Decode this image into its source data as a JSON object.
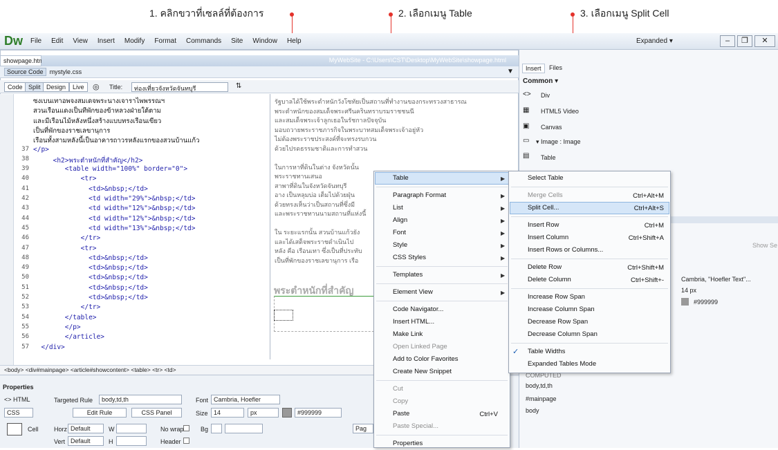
{
  "callouts": [
    "1. คลิกขวาที่เซลล์ที่ต้องการ",
    "2. เลือกเมนู Table",
    "3. เลือกเมนู Split Cell"
  ],
  "app": {
    "logo": "Dw",
    "menus": [
      "File",
      "Edit",
      "View",
      "Insert",
      "Modify",
      "Format",
      "Commands",
      "Site",
      "Window",
      "Help"
    ],
    "workspace": "Expanded ▾"
  },
  "doc": {
    "tab": "showpage.html* ×",
    "path": "MyWebSite - C:\\Users\\CST\\Desktop\\MyWebSite\\showpage.html",
    "source": "Source Code",
    "css": "mystyle.css",
    "views": [
      "Code",
      "Split",
      "Design",
      "Live"
    ],
    "title_label": "Title:",
    "title_value": "ท่องเที่ยวจังหวัดจันทบุรี"
  },
  "code_lines": [
    {
      "n": "",
      "t": "ซงเบนเทาอพจงสมเดจพระนางเจาราไพพรรณฯ"
    },
    {
      "n": "",
      "t": "สวนเรือนแดงเป็นทีพักของข้าหลวงฝ่ายใต้ตาม"
    },
    {
      "n": "",
      "t": "และมีเรือนไม้หลังหนึ่งสร้างแบบทรงเรือนเขียว"
    },
    {
      "n": "",
      "t": "เป็นที่พักของราชเลขานุการ"
    },
    {
      "n": "",
      "t": "เรือนทั้งสามหลังนี้เป็นอาคารถาวรหลังแรกของสวนบ้านแก้ว"
    },
    {
      "n": "37",
      "t": "</p>"
    },
    {
      "n": "38",
      "t": "     <h2>พระตำหนักที่สำคัญ</h2>"
    },
    {
      "n": "39",
      "t": "        <table width=\"100%\" border=\"0\">"
    },
    {
      "n": "40",
      "t": "            <tr>"
    },
    {
      "n": "41",
      "t": "              <td>&nbsp;</td>"
    },
    {
      "n": "42",
      "t": "              <td width=\"29%\">&nbsp;</td>"
    },
    {
      "n": "43",
      "t": "              <td width=\"12%\">&nbsp;</td>"
    },
    {
      "n": "44",
      "t": "              <td width=\"12%\">&nbsp;</td>"
    },
    {
      "n": "45",
      "t": "              <td width=\"13%\">&nbsp;</td>"
    },
    {
      "n": "46",
      "t": "            </tr>"
    },
    {
      "n": "47",
      "t": "            <tr>"
    },
    {
      "n": "48",
      "t": "              <td>&nbsp;</td>"
    },
    {
      "n": "49",
      "t": "              <td>&nbsp;</td>"
    },
    {
      "n": "50",
      "t": "              <td>&nbsp;</td>"
    },
    {
      "n": "51",
      "t": "              <td>&nbsp;</td>"
    },
    {
      "n": "52",
      "t": "              <td>&nbsp;</td>"
    },
    {
      "n": "53",
      "t": "            </tr>"
    },
    {
      "n": "54",
      "t": "        </table>"
    },
    {
      "n": "55",
      "t": "        </p>"
    },
    {
      "n": "56",
      "t": "        </article>"
    },
    {
      "n": "57",
      "t": "  </div>"
    }
  ],
  "design_text": [
    "รัฐบาลได้ใช้พระตำหนักวังโซทัยเป็นสถานที่ทำงานของกระทรวงสาธารณ",
    "พระตำหนักของสมเด็จพระศรีนครินทราบรมราชชนนี",
    "และสมเด็จพระเจ้าลูกเธอในรัชกาลปัจจุบัน",
    "มอบถวายพระราชภารกิจในพระบาทสมเด็จพระเจ้าอยู่หัว",
    "ไม่ต้องพระราชประสงค์ที่จะทรงรบกวน",
    "ด้วยไปรดธรรมชาติและการทำสวน",
    "",
    "ในการหาที่ดินในต่าง จังหวัดนั้น",
    "พระราชทานเสนอ",
    "สาพาที่ดินในจังหวัดจันทบุรี",
    "อาง เป็นหลุมบ่อ เต็มไปด้วยฝุ่น",
    "ด้วยทรงเห็นว่าเป็นสถานที่ซึ่งมี",
    "และพระราชทานนามสถานที่แห่งนี้",
    "",
    "ใน ระยะแรกนั้น สวนบ้านแก้วยัง",
    "และได้เสด็จพระราชดำเนินไป",
    "หลัง คือ เรือนเทา ซึ่งเป็นที่ประทับ",
    "เป็นที่พักของราชเลขานุการ เรือ"
  ],
  "design_heading": "พระตำหนักที่สำคัญ",
  "tagbar": "<body> <div#mainpage> <article#showcontent> <table> <tr> <td>",
  "props": {
    "title": "Properties",
    "html": "<> HTML",
    "css": "CSS",
    "targeted_rule_label": "Targeted Rule",
    "targeted_rule": "body,td,th",
    "edit_rule": "Edit Rule",
    "css_panel": "CSS Panel",
    "font_label": "Font",
    "font_value": "Cambria, Hoefler",
    "size_label": "Size",
    "size_value": "14",
    "unit": "px",
    "color": "#999999",
    "cell": "Cell",
    "horz": "Horz",
    "horz_val": "Default",
    "vert": "Vert",
    "vert_val": "Default",
    "w": "W",
    "h": "H",
    "nowrap": "No wrap",
    "bg": "Bg",
    "header": "Header",
    "page": "Pag"
  },
  "insert_panel": {
    "tabs": [
      "Insert",
      "Files"
    ],
    "category": "Common ▾",
    "items": [
      "Div",
      "HTML5 Video",
      "Canvas",
      "▾ Image : Image",
      "Table"
    ]
  },
  "css_panel": {
    "show": "Show Se",
    "font": "Cambria, \"Hoefler Text\"...",
    "size": "14 px",
    "color": "#999999",
    "computed": "COMPUTED",
    "rules": [
      "body,td,th",
      "#mainpage",
      "body"
    ]
  },
  "context_menu": [
    {
      "label": "Table",
      "sub": true,
      "hl": true
    },
    {
      "sep": true
    },
    {
      "label": "Paragraph Format",
      "sub": true
    },
    {
      "label": "List",
      "sub": true
    },
    {
      "label": "Align",
      "sub": true
    },
    {
      "label": "Font",
      "sub": true
    },
    {
      "label": "Style",
      "sub": true
    },
    {
      "label": "CSS Styles",
      "sub": true
    },
    {
      "sep": true
    },
    {
      "label": "Templates",
      "sub": true
    },
    {
      "sep": true
    },
    {
      "label": "Element View",
      "sub": true
    },
    {
      "sep": true
    },
    {
      "label": "Code Navigator..."
    },
    {
      "label": "Insert HTML..."
    },
    {
      "label": "Make Link"
    },
    {
      "label": "Open Linked Page",
      "dis": true
    },
    {
      "label": "Add to Color Favorites"
    },
    {
      "label": "Create New Snippet"
    },
    {
      "sep": true
    },
    {
      "label": "Cut",
      "dis": true
    },
    {
      "label": "Copy",
      "dis": true
    },
    {
      "label": "Paste",
      "sc": "Ctrl+V"
    },
    {
      "label": "Paste Special...",
      "dis": true
    },
    {
      "sep": true
    },
    {
      "label": "Properties"
    }
  ],
  "submenu": [
    {
      "label": "Select Table"
    },
    {
      "sep": true
    },
    {
      "label": "Merge Cells",
      "sc": "Ctrl+Alt+M",
      "dis": true
    },
    {
      "label": "Split Cell...",
      "sc": "Ctrl+Alt+S",
      "hl": true
    },
    {
      "sep": true
    },
    {
      "label": "Insert Row",
      "sc": "Ctrl+M"
    },
    {
      "label": "Insert Column",
      "sc": "Ctrl+Shift+A"
    },
    {
      "label": "Insert Rows or Columns..."
    },
    {
      "sep": true
    },
    {
      "label": "Delete Row",
      "sc": "Ctrl+Shift+M"
    },
    {
      "label": "Delete Column",
      "sc": "Ctrl+Shift+-"
    },
    {
      "sep": true
    },
    {
      "label": "Increase Row Span"
    },
    {
      "label": "Increase Column Span"
    },
    {
      "label": "Decrease Row Span"
    },
    {
      "label": "Decrease Column Span"
    },
    {
      "sep": true
    },
    {
      "label": "Table Widths",
      "check": true
    },
    {
      "label": "Expanded Tables Mode"
    }
  ]
}
